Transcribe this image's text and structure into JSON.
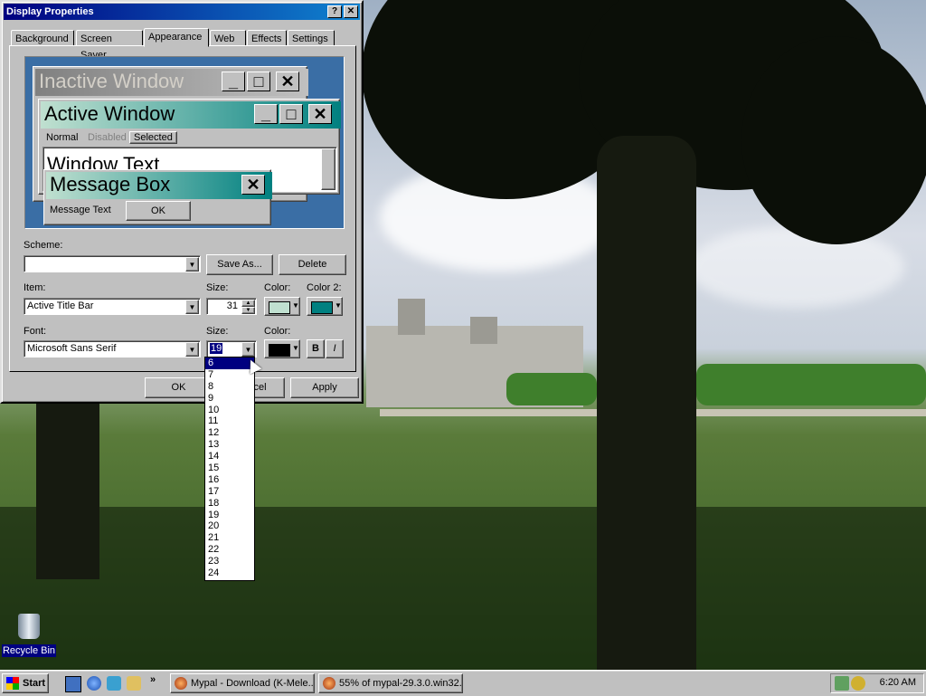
{
  "window": {
    "title": "Display Properties",
    "help_button": "?",
    "close_button": "✕"
  },
  "tabs": [
    {
      "label": "Background"
    },
    {
      "label": "Screen Saver"
    },
    {
      "label": "Appearance"
    },
    {
      "label": "Web"
    },
    {
      "label": "Effects"
    },
    {
      "label": "Settings"
    }
  ],
  "preview": {
    "inactive_title": "Inactive Window",
    "active_title": "Active Window",
    "menu_normal": "Normal",
    "menu_disabled": "Disabled",
    "menu_selected": "Selected",
    "window_text": "Window Text",
    "message_title": "Message Box",
    "message_text": "Message Text",
    "ok_label": "OK"
  },
  "scheme": {
    "label": "Scheme:",
    "value": "",
    "save_as": "Save As...",
    "delete": "Delete"
  },
  "item": {
    "label": "Item:",
    "value": "Active Title Bar",
    "size_label": "Size:",
    "size_value": "31",
    "color_label": "Color:",
    "color2_label": "Color 2:",
    "color_hex": "#c0e0d0",
    "color2_hex": "#008080"
  },
  "font": {
    "label": "Font:",
    "value": "Microsoft Sans Serif",
    "size_label": "Size:",
    "size_value": "19",
    "color_label": "Color:",
    "color_hex": "#000000",
    "bold": "B",
    "italic": "I"
  },
  "size_options": [
    "6",
    "7",
    "8",
    "9",
    "10",
    "11",
    "12",
    "13",
    "14",
    "15",
    "16",
    "17",
    "18",
    "19",
    "20",
    "21",
    "22",
    "23",
    "24"
  ],
  "selected_size_option": "6",
  "footer": {
    "ok": "OK",
    "cancel": "Cancel",
    "apply": "Apply"
  },
  "desktop": {
    "recycle_bin": "Recycle Bin"
  },
  "taskbar": {
    "start": "Start",
    "chevron": "»",
    "task1": "Mypal - Download (K-Mele...",
    "task2": "55% of mypal-29.3.0.win32...",
    "clock": "6:20 AM"
  },
  "colors": {
    "title_active": "#000080",
    "preview_active": "#008080",
    "desktop_blue": "#3a6ea5",
    "selection": "#000080"
  }
}
